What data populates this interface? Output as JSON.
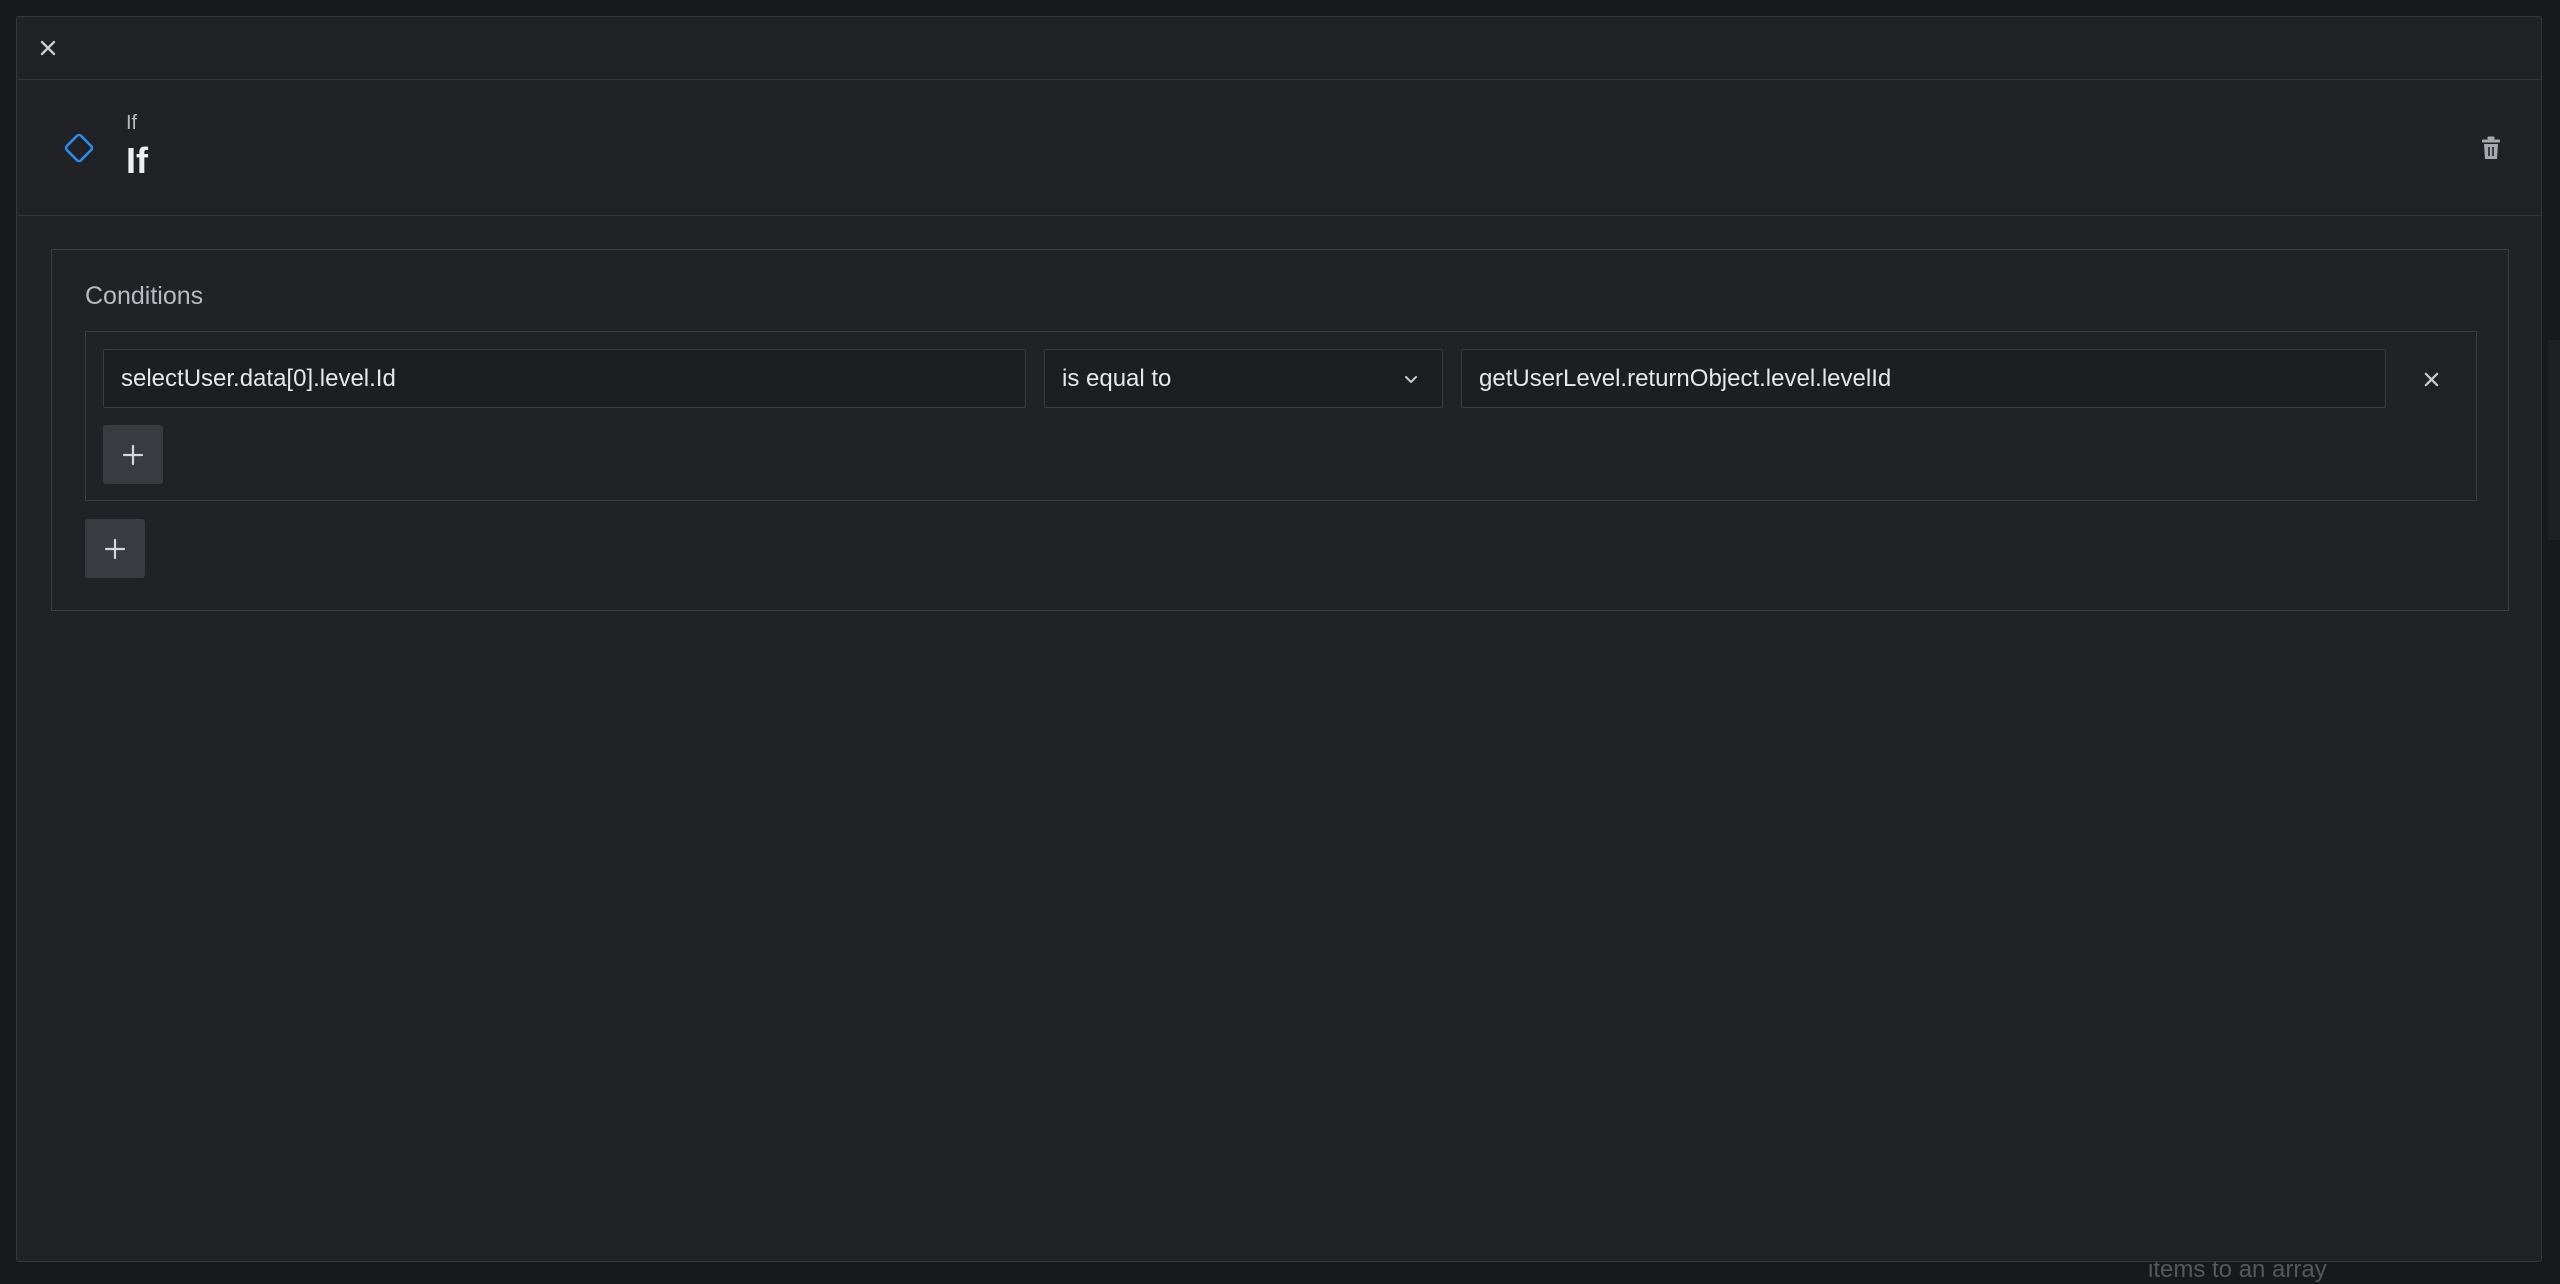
{
  "background": {
    "hint_text": "items to an array"
  },
  "modal": {
    "close_icon": "close-icon",
    "node": {
      "icon": "diamond-icon",
      "icon_color": "#2a8cf0",
      "subtitle": "If",
      "title": "If"
    },
    "delete_icon": "trash-icon",
    "conditions": {
      "label": "Conditions",
      "rows": [
        {
          "left_value": "selectUser.data[0].level.Id",
          "operator": "is equal to",
          "right_value": "getUserLevel.returnObject.level.levelId"
        }
      ],
      "add_condition_icon": "plus-icon",
      "add_group_icon": "plus-icon"
    }
  }
}
